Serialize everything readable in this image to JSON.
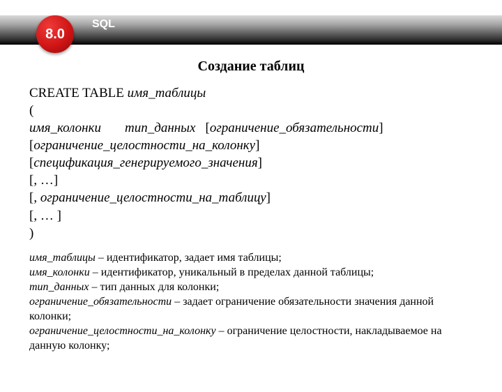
{
  "header": {
    "sql_label": "SQL",
    "badge": "8.0"
  },
  "title": "Создание таблиц",
  "syntax": {
    "kw_create": "CREATE TABLE",
    "table_name": "имя_таблицы",
    "open_paren": "(",
    "col_name": "имя_колонки",
    "data_type": "тип_данных",
    "opt_null_l": "[",
    "opt_null": "ограничение_обязательности",
    "opt_null_r": "]",
    "col_constraint_l": "[",
    "col_constraint": "ограничение_целостности_на_колонку",
    "col_constraint_r": "]",
    "gen_spec_l": "[",
    "gen_spec": "спецификация_генерируемого_значения",
    "gen_spec_r": "]",
    "repeat1": "[, …]",
    "table_constraint_pre": "[, ",
    "table_constraint": "ограничение_целостности_на_таблицу",
    "table_constraint_post": "]",
    "repeat2": "[, … ]",
    "close_paren": ")"
  },
  "defs": {
    "d1_term": "имя_таблицы",
    "d1_text": " – идентификатор, задает имя таблицы;",
    "d2_term": "имя_колонки",
    "d2_text": " – идентификатор, уникальный в пределах данной таблицы;",
    "d3_term": "тип_данных",
    "d3_text": " – тип данных для колонки;",
    "d4_term": "ограничение_обязательности",
    "d4_text": " – задает ограничение обязательности значения данной колонки;",
    "d5_term": "ограничение_целостности_на_колонку",
    "d5_text": " – ограничение целостности, накладываемое на данную колонку;"
  }
}
